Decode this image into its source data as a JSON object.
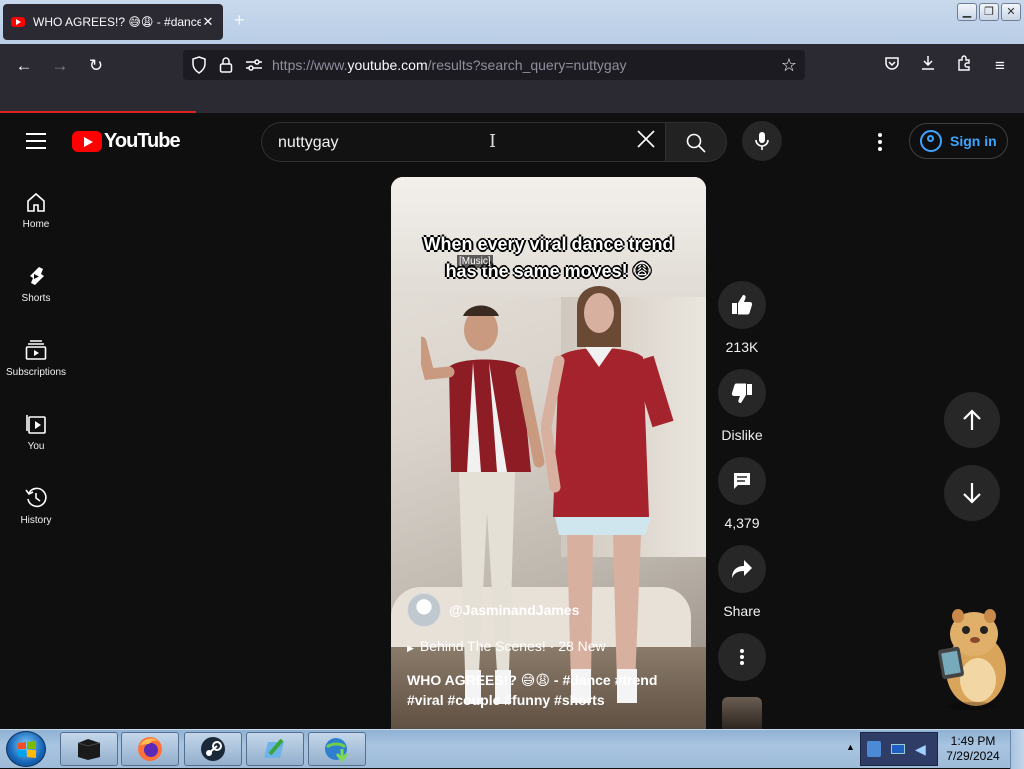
{
  "browser": {
    "tab_title": "WHO AGREES!? 😅😩 - #dance #",
    "new_tab": "+",
    "url_prefix": "https://www.",
    "url_domain": "youtube.com",
    "url_path": "/results?search_query=nuttygay",
    "window_controls": [
      "minimize",
      "maximize",
      "close"
    ]
  },
  "youtube": {
    "logo_text": "YouTube",
    "search_query": "nuttygay",
    "sign_in_label": "Sign in",
    "sidebar": [
      {
        "label": "Home",
        "icon": "home-icon"
      },
      {
        "label": "Shorts",
        "icon": "shorts-icon"
      },
      {
        "label": "Subscriptions",
        "icon": "subscriptions-icon"
      },
      {
        "label": "You",
        "icon": "you-icon"
      },
      {
        "label": "History",
        "icon": "history-icon"
      }
    ],
    "short": {
      "caption_line1": "When every viral dance trend",
      "caption_line2": "has the same moves! 😩",
      "music_tag": "[Music]",
      "channel": "@JasminandJames",
      "playlist": "Behind The Scenes! · 28 New",
      "description": "WHO AGREES!? 😅😩 - #dance #trend #viral #couple #funny #shorts"
    },
    "actions": {
      "likes": "213K",
      "dislike_label": "Dislike",
      "comments": "4,379",
      "share_label": "Share"
    }
  },
  "taskbar": {
    "time": "1:49 PM",
    "date": "7/29/2024",
    "apps": [
      "terminal",
      "firefox",
      "steam",
      "file-manager",
      "internet-download-manager"
    ]
  },
  "colors": {
    "yt_red": "#ff0000",
    "bg": "#0f0f0f",
    "link_blue": "#3ea6ff",
    "firefox_toolbar": "#2b2a33"
  }
}
